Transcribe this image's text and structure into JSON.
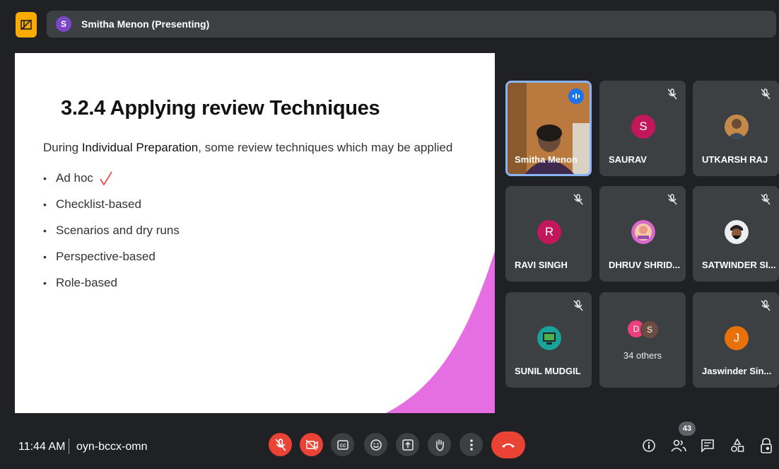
{
  "header": {
    "presenter_initial": "S",
    "presenter_label": "Smitha Menon (Presenting)"
  },
  "slide": {
    "title": "3.2.4 Applying review Techniques",
    "intro_pre": "During ",
    "intro_highlight": "Individual Preparation",
    "intro_post": ", some review techniques which may be applied",
    "bullets": [
      "Ad hoc",
      "Checklist-based",
      "Scenarios and dry runs",
      "Perspective-based",
      "Role-based"
    ],
    "accent_color": "#e56ee3"
  },
  "participants": [
    {
      "name": "Smitha Menon",
      "speaking": true,
      "avatar": "photo"
    },
    {
      "name": "SAURAV",
      "initial": "S",
      "color": "#c2185b",
      "muted": true
    },
    {
      "name": "UTKARSH RAJ",
      "avatar": "photo",
      "muted": true
    },
    {
      "name": "RAVI SINGH",
      "initial": "R",
      "color": "#c2185b",
      "muted": true
    },
    {
      "name": "DHRUV SHRID...",
      "avatar": "photo",
      "muted": true
    },
    {
      "name": "SATWINDER SI...",
      "avatar": "photo",
      "muted": true
    },
    {
      "name": "SUNIL MUDGIL",
      "avatar": "photo",
      "muted": true
    },
    {
      "others_label": "34 others",
      "initials": [
        "D",
        "S"
      ]
    },
    {
      "name": "Jaswinder Sin...",
      "initial": "J",
      "color": "#e8710a",
      "muted": true
    }
  ],
  "footer": {
    "time": "11:44 AM",
    "meeting_code": "oyn-bccx-omn",
    "participant_count": "43"
  },
  "colors": {
    "end_call": "#ea4335",
    "active_border": "#8ab4f8",
    "layout_button": "#f9ab00"
  }
}
